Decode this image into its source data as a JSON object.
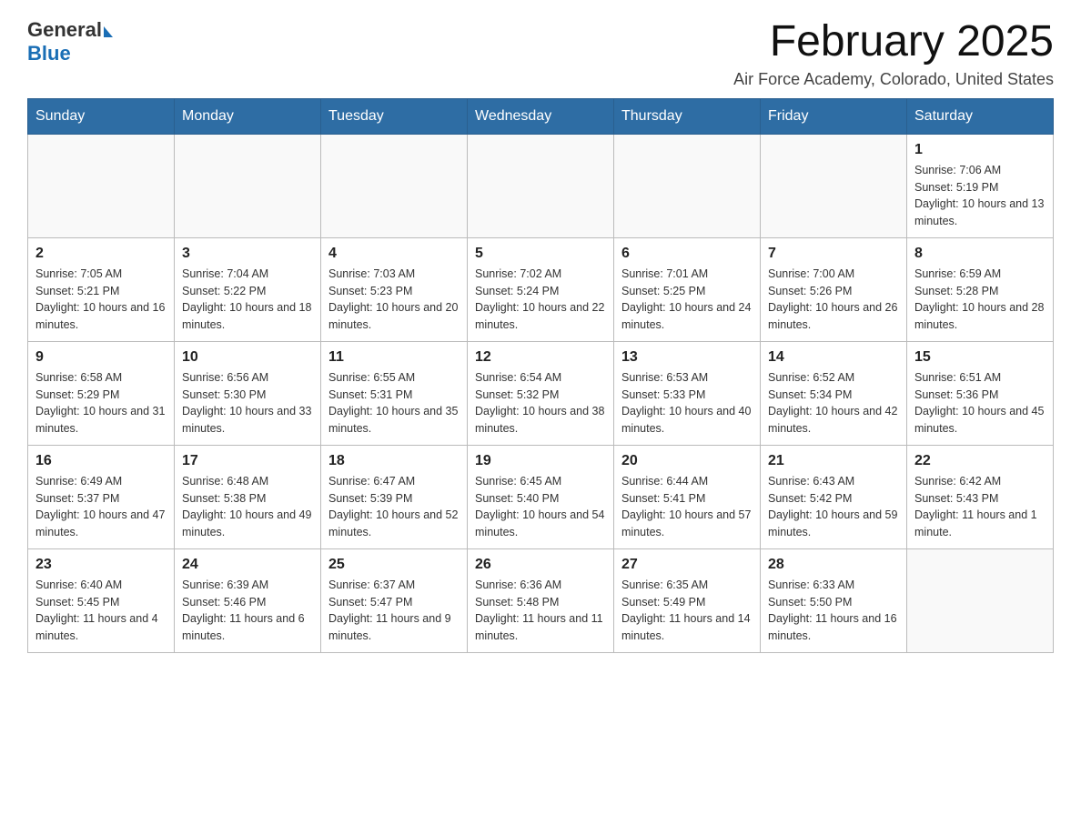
{
  "header": {
    "logo_general": "General",
    "logo_blue": "Blue",
    "month_title": "February 2025",
    "location": "Air Force Academy, Colorado, United States"
  },
  "days_of_week": [
    "Sunday",
    "Monday",
    "Tuesday",
    "Wednesday",
    "Thursday",
    "Friday",
    "Saturday"
  ],
  "weeks": [
    [
      {
        "day": "",
        "info": ""
      },
      {
        "day": "",
        "info": ""
      },
      {
        "day": "",
        "info": ""
      },
      {
        "day": "",
        "info": ""
      },
      {
        "day": "",
        "info": ""
      },
      {
        "day": "",
        "info": ""
      },
      {
        "day": "1",
        "info": "Sunrise: 7:06 AM\nSunset: 5:19 PM\nDaylight: 10 hours and 13 minutes."
      }
    ],
    [
      {
        "day": "2",
        "info": "Sunrise: 7:05 AM\nSunset: 5:21 PM\nDaylight: 10 hours and 16 minutes."
      },
      {
        "day": "3",
        "info": "Sunrise: 7:04 AM\nSunset: 5:22 PM\nDaylight: 10 hours and 18 minutes."
      },
      {
        "day": "4",
        "info": "Sunrise: 7:03 AM\nSunset: 5:23 PM\nDaylight: 10 hours and 20 minutes."
      },
      {
        "day": "5",
        "info": "Sunrise: 7:02 AM\nSunset: 5:24 PM\nDaylight: 10 hours and 22 minutes."
      },
      {
        "day": "6",
        "info": "Sunrise: 7:01 AM\nSunset: 5:25 PM\nDaylight: 10 hours and 24 minutes."
      },
      {
        "day": "7",
        "info": "Sunrise: 7:00 AM\nSunset: 5:26 PM\nDaylight: 10 hours and 26 minutes."
      },
      {
        "day": "8",
        "info": "Sunrise: 6:59 AM\nSunset: 5:28 PM\nDaylight: 10 hours and 28 minutes."
      }
    ],
    [
      {
        "day": "9",
        "info": "Sunrise: 6:58 AM\nSunset: 5:29 PM\nDaylight: 10 hours and 31 minutes."
      },
      {
        "day": "10",
        "info": "Sunrise: 6:56 AM\nSunset: 5:30 PM\nDaylight: 10 hours and 33 minutes."
      },
      {
        "day": "11",
        "info": "Sunrise: 6:55 AM\nSunset: 5:31 PM\nDaylight: 10 hours and 35 minutes."
      },
      {
        "day": "12",
        "info": "Sunrise: 6:54 AM\nSunset: 5:32 PM\nDaylight: 10 hours and 38 minutes."
      },
      {
        "day": "13",
        "info": "Sunrise: 6:53 AM\nSunset: 5:33 PM\nDaylight: 10 hours and 40 minutes."
      },
      {
        "day": "14",
        "info": "Sunrise: 6:52 AM\nSunset: 5:34 PM\nDaylight: 10 hours and 42 minutes."
      },
      {
        "day": "15",
        "info": "Sunrise: 6:51 AM\nSunset: 5:36 PM\nDaylight: 10 hours and 45 minutes."
      }
    ],
    [
      {
        "day": "16",
        "info": "Sunrise: 6:49 AM\nSunset: 5:37 PM\nDaylight: 10 hours and 47 minutes."
      },
      {
        "day": "17",
        "info": "Sunrise: 6:48 AM\nSunset: 5:38 PM\nDaylight: 10 hours and 49 minutes."
      },
      {
        "day": "18",
        "info": "Sunrise: 6:47 AM\nSunset: 5:39 PM\nDaylight: 10 hours and 52 minutes."
      },
      {
        "day": "19",
        "info": "Sunrise: 6:45 AM\nSunset: 5:40 PM\nDaylight: 10 hours and 54 minutes."
      },
      {
        "day": "20",
        "info": "Sunrise: 6:44 AM\nSunset: 5:41 PM\nDaylight: 10 hours and 57 minutes."
      },
      {
        "day": "21",
        "info": "Sunrise: 6:43 AM\nSunset: 5:42 PM\nDaylight: 10 hours and 59 minutes."
      },
      {
        "day": "22",
        "info": "Sunrise: 6:42 AM\nSunset: 5:43 PM\nDaylight: 11 hours and 1 minute."
      }
    ],
    [
      {
        "day": "23",
        "info": "Sunrise: 6:40 AM\nSunset: 5:45 PM\nDaylight: 11 hours and 4 minutes."
      },
      {
        "day": "24",
        "info": "Sunrise: 6:39 AM\nSunset: 5:46 PM\nDaylight: 11 hours and 6 minutes."
      },
      {
        "day": "25",
        "info": "Sunrise: 6:37 AM\nSunset: 5:47 PM\nDaylight: 11 hours and 9 minutes."
      },
      {
        "day": "26",
        "info": "Sunrise: 6:36 AM\nSunset: 5:48 PM\nDaylight: 11 hours and 11 minutes."
      },
      {
        "day": "27",
        "info": "Sunrise: 6:35 AM\nSunset: 5:49 PM\nDaylight: 11 hours and 14 minutes."
      },
      {
        "day": "28",
        "info": "Sunrise: 6:33 AM\nSunset: 5:50 PM\nDaylight: 11 hours and 16 minutes."
      },
      {
        "day": "",
        "info": ""
      }
    ]
  ]
}
